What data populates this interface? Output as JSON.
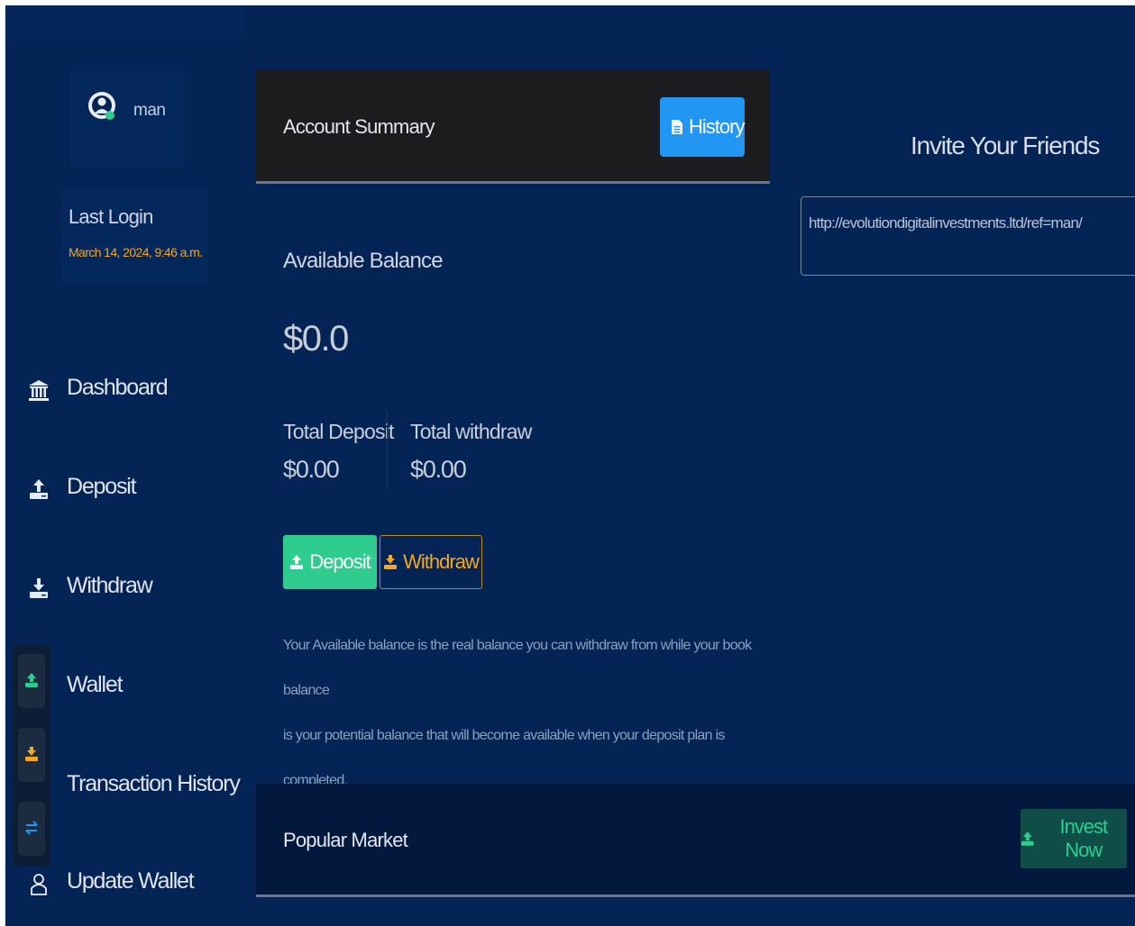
{
  "profile": {
    "username": "man"
  },
  "last_login": {
    "label": "Last Login",
    "date": "March 14, 2024, 9:46 a.m."
  },
  "nav": {
    "items": [
      {
        "label": "Dashboard",
        "icon": "bank-icon"
      },
      {
        "label": "Deposit",
        "icon": "upload-icon"
      },
      {
        "label": "Withdraw",
        "icon": "download-icon"
      },
      {
        "label": "Wallet",
        "icon": "wallet-icon"
      },
      {
        "label": "Transaction History",
        "icon": "history-icon"
      },
      {
        "label": "Update Wallet",
        "icon": "user-icon"
      }
    ]
  },
  "quick_actions": [
    {
      "icon": "upload-icon",
      "color": "#2ecc8f"
    },
    {
      "icon": "download-icon",
      "color": "#f5a623"
    },
    {
      "icon": "transfer-icon",
      "color": "#2196f3"
    }
  ],
  "account_summary": {
    "title": "Account Summary",
    "history_label": "History",
    "available_label": "Available Balance",
    "available_value": "$0.0",
    "total_deposit_label": "Total Deposit",
    "total_deposit_value": "$0.00",
    "total_withdraw_label": "Total withdraw",
    "total_withdraw_value": "$0.00",
    "deposit_label": "Deposit",
    "withdraw_label": "Withdraw",
    "note_line1": "Your Available balance is the real balance you can withdraw from while your book balance",
    "note_line2": "is your potential balance that will become available when your deposit plan is completed."
  },
  "invite": {
    "title": "Invite Your Friends",
    "referral_link": "http://evolutiondigitalinvestments.ltd/ref=man/"
  },
  "market": {
    "title": "Popular Market",
    "invest_label": "Invest Now"
  },
  "colors": {
    "background": "#032454",
    "accent_blue": "#2196f3",
    "accent_green": "#2ecc8f",
    "accent_orange": "#f5a623"
  }
}
